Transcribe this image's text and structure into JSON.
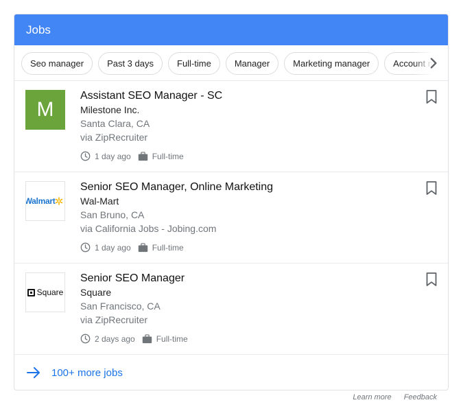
{
  "header": {
    "title": "Jobs"
  },
  "chips": [
    "Seo manager",
    "Past 3 days",
    "Full-time",
    "Manager",
    "Marketing manager",
    "Account manager"
  ],
  "jobs": [
    {
      "title": "Assistant SEO Manager - SC",
      "company": "Milestone Inc.",
      "location": "Santa Clara, CA",
      "via": "via ZipRecruiter",
      "posted": "1 day ago",
      "type": "Full-time",
      "logo_letter": "M",
      "logo_color": "#6aa43a"
    },
    {
      "title": "Senior SEO Manager, Online Marketing",
      "company": "Wal-Mart",
      "location": "San Bruno, CA",
      "via": "via California Jobs - Jobing.com",
      "posted": "1 day ago",
      "type": "Full-time",
      "logo_text": "Walmart",
      "logo_color": "#1a75cf",
      "spark_color": "#f4b400"
    },
    {
      "title": "Senior SEO Manager",
      "company": "Square",
      "location": "San Francisco, CA",
      "via": "via ZipRecruiter",
      "posted": "2 days ago",
      "type": "Full-time",
      "logo_text": "Square"
    }
  ],
  "more": {
    "label": "100+ more jobs"
  },
  "footer": {
    "learn_more": "Learn more",
    "feedback": "Feedback"
  },
  "colors": {
    "header": "#4285f4",
    "link": "#1a73e8",
    "muted": "#70757a"
  },
  "icons": {
    "chevron": "chevron-right-icon",
    "bookmark": "bookmark-icon",
    "clock": "clock-icon",
    "briefcase": "briefcase-icon",
    "arrow": "arrow-right-icon"
  }
}
